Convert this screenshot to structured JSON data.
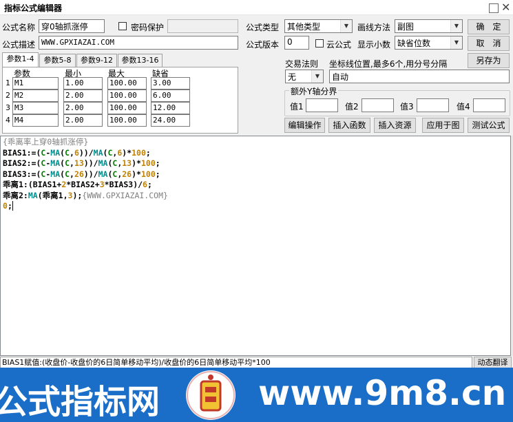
{
  "window": {
    "title": "指标公式编辑器"
  },
  "form": {
    "name_label": "公式名称",
    "name_value": "穿0轴抓涨停",
    "password_label": "密码保护",
    "desc_label": "公式描述",
    "desc_value": "WWW.GPXIAZAI.COM",
    "type_label": "公式类型",
    "type_value": "其他类型",
    "draw_label": "画线方法",
    "draw_value": "副图",
    "version_label": "公式版本",
    "version_value": "0",
    "cloud_label": "云公式",
    "decimals_label": "显示小数",
    "decimals_value": "缺省位数",
    "trade_label": "交易法则",
    "trade_value": "无",
    "axis_label": "坐标线位置,最多6个,用分号分隔",
    "axis_value": "自动",
    "yaxis_group": "额外Y轴分界",
    "y_values": [
      "值1",
      "值2",
      "值3",
      "值4"
    ]
  },
  "buttons": {
    "ok": "确　定",
    "cancel": "取　消",
    "save_as": "另存为",
    "edit_ops": "编辑操作",
    "insert_func": "插入函数",
    "insert_res": "插入资源",
    "apply": "应用于图",
    "test": "测试公式",
    "translate": "动态翻译"
  },
  "tabs": [
    "参数1-4",
    "参数5-8",
    "参数9-12",
    "参数13-16"
  ],
  "params": {
    "headers": [
      "参数",
      "最小",
      "最大",
      "缺省"
    ],
    "rows": [
      {
        "idx": "1",
        "name": "M1",
        "min": "1.00",
        "max": "100.00",
        "def": "3.00"
      },
      {
        "idx": "2",
        "name": "M2",
        "min": "2.00",
        "max": "100.00",
        "def": "6.00"
      },
      {
        "idx": "3",
        "name": "M3",
        "min": "2.00",
        "max": "100.00",
        "def": "12.00"
      },
      {
        "idx": "4",
        "name": "M4",
        "min": "2.00",
        "max": "100.00",
        "def": "24.00"
      }
    ]
  },
  "editor": {
    "lines": [
      [
        [
          "c",
          "{乖离率上穿0轴抓涨停}"
        ]
      ],
      [
        [
          "k",
          "BIAS1:=("
        ],
        [
          "g",
          "C"
        ],
        [
          "k",
          "-"
        ],
        [
          "f",
          "MA"
        ],
        [
          "k",
          "("
        ],
        [
          "g",
          "C"
        ],
        [
          "k",
          ","
        ],
        [
          "n",
          "6"
        ],
        [
          "k",
          "))/"
        ],
        [
          "f",
          "MA"
        ],
        [
          "k",
          "("
        ],
        [
          "g",
          "C"
        ],
        [
          "k",
          ","
        ],
        [
          "n",
          "6"
        ],
        [
          "k",
          ")*"
        ],
        [
          "n",
          "100"
        ],
        [
          "k",
          ";"
        ]
      ],
      [
        [
          "k",
          "BIAS2:=("
        ],
        [
          "g",
          "C"
        ],
        [
          "k",
          "-"
        ],
        [
          "f",
          "MA"
        ],
        [
          "k",
          "("
        ],
        [
          "g",
          "C"
        ],
        [
          "k",
          ","
        ],
        [
          "n",
          "13"
        ],
        [
          "k",
          "))/"
        ],
        [
          "f",
          "MA"
        ],
        [
          "k",
          "("
        ],
        [
          "g",
          "C"
        ],
        [
          "k",
          ","
        ],
        [
          "n",
          "13"
        ],
        [
          "k",
          ")*"
        ],
        [
          "n",
          "100"
        ],
        [
          "k",
          ";"
        ]
      ],
      [
        [
          "k",
          "BIAS3:=("
        ],
        [
          "g",
          "C"
        ],
        [
          "k",
          "-"
        ],
        [
          "f",
          "MA"
        ],
        [
          "k",
          "("
        ],
        [
          "g",
          "C"
        ],
        [
          "k",
          ","
        ],
        [
          "n",
          "26"
        ],
        [
          "k",
          "))/"
        ],
        [
          "f",
          "MA"
        ],
        [
          "k",
          "("
        ],
        [
          "g",
          "C"
        ],
        [
          "k",
          ","
        ],
        [
          "n",
          "26"
        ],
        [
          "k",
          ")*"
        ],
        [
          "n",
          "100"
        ],
        [
          "k",
          ";"
        ]
      ],
      [
        [
          "k",
          "乖离1:(BIAS1+"
        ],
        [
          "n",
          "2"
        ],
        [
          "k",
          "*BIAS2+"
        ],
        [
          "n",
          "3"
        ],
        [
          "k",
          "*BIAS3)/"
        ],
        [
          "n",
          "6"
        ],
        [
          "k",
          ";"
        ]
      ],
      [
        [
          "k",
          "乖离2:"
        ],
        [
          "f",
          "MA"
        ],
        [
          "k",
          "(乖离1,"
        ],
        [
          "n",
          "3"
        ],
        [
          "k",
          ");"
        ],
        [
          "c",
          "{WWW.GPXIAZAI.COM}"
        ]
      ],
      [
        [
          "n",
          "0"
        ],
        [
          "k",
          ";"
        ]
      ]
    ]
  },
  "status": {
    "text": "BIAS1赋值:(收盘价-收盘价的6日简单移动平均)/收盘价的6日简单移动平均*100"
  },
  "banner": {
    "left_text": "公式指标网",
    "right_text": "www.9m8.cn",
    "logo_text": "www.9m8.cn"
  },
  "colors": {
    "banner": "#1b6ec8",
    "comment": "#808080",
    "number": "#c08000",
    "function": "#008b8b",
    "variable": "#008000"
  }
}
